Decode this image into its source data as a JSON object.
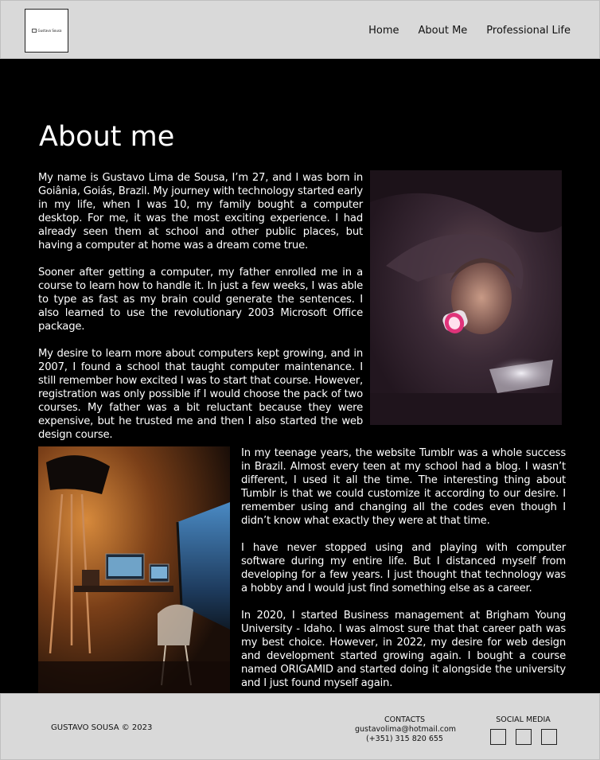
{
  "header": {
    "logo_text": "Gustavo Sousa",
    "nav": [
      "Home",
      "About Me",
      "Professional Life"
    ]
  },
  "main": {
    "title": "About me",
    "section1": [
      "My name is Gustavo Lima de Sousa, I’m 27, and I was born in Goiânia, Goiás, Brazil. My journey with technology started early in my life, when I was 10, my family bought a computer desktop. For me, it was the most exciting experience. I had already seen them at school and other public places, but having a computer at home was a dream come true.",
      "Sooner after getting a computer, my father enrolled me in a course to learn how to handle it. In just a few weeks, I was able to type as fast as my brain could generate the sentences. I also learned to use the revolutionary 2003 Microsoft Office package.",
      "My desire to learn more about computers kept growing, and in 2007, I found a school that taught computer maintenance. I still remember how excited I was to start that course. However, registration was only possible if I would choose the pack of two courses. My father was a bit reluctant because they were expensive, but he trusted me and then I also started the web design course."
    ],
    "section2": [
      "In my teenage years, the website Tumblr was a whole success in Brazil. Almost every teen at my school had a blog. I wasn’t different, I used it all the time. The interesting thing about Tumblr is that we could customize it according to our desire. I remember using and changing all the codes even though I didn’t know what exactly they were at that time.",
      "I have never stopped using and playing with computer software during my entire life. But I distanced myself from developing for a few years. I just thought that technology was a hobby and I would just find something else as a career.",
      "In 2020, I started Business management at Brigham Young University - Idaho. I was almost sure that that career path was my best choice. However, in 2022, my desire for web design and development started growing again. I bought a course named ORIGAMID and started doing it alongside the university and I just found myself again."
    ]
  },
  "footer": {
    "copyright": "GUSTAVO SOUSA © 2023",
    "contacts_title": "CONTACTS",
    "email": "gustavolima@hotmail.com",
    "phone": "(+351) 315 820 655",
    "social_title": "SOCIAL MEDIA"
  }
}
